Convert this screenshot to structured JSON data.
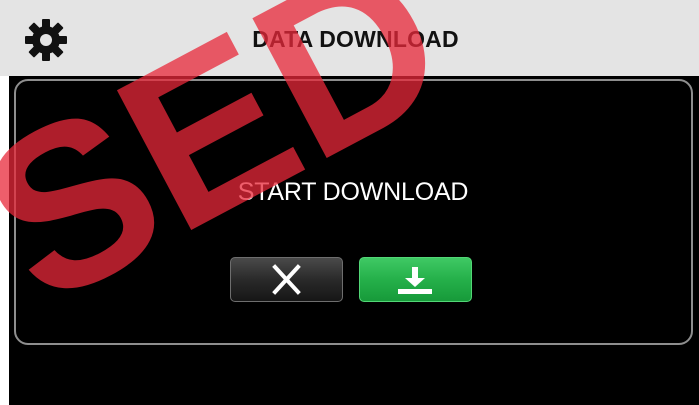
{
  "header": {
    "title": "DATA DOWNLOAD",
    "settings_icon": "gear-icon"
  },
  "dialog": {
    "message": "START DOWNLOAD",
    "cancel_icon": "close-icon",
    "confirm_icon": "download-icon"
  },
  "watermark": {
    "text": "SED",
    "color": "#e8283a"
  },
  "colors": {
    "header_bg": "#e4e4e4",
    "screen_bg": "#000000",
    "panel_border": "#8e8e8e",
    "confirm_green": "#25b04a",
    "cancel_dark": "#2a2a2a"
  }
}
